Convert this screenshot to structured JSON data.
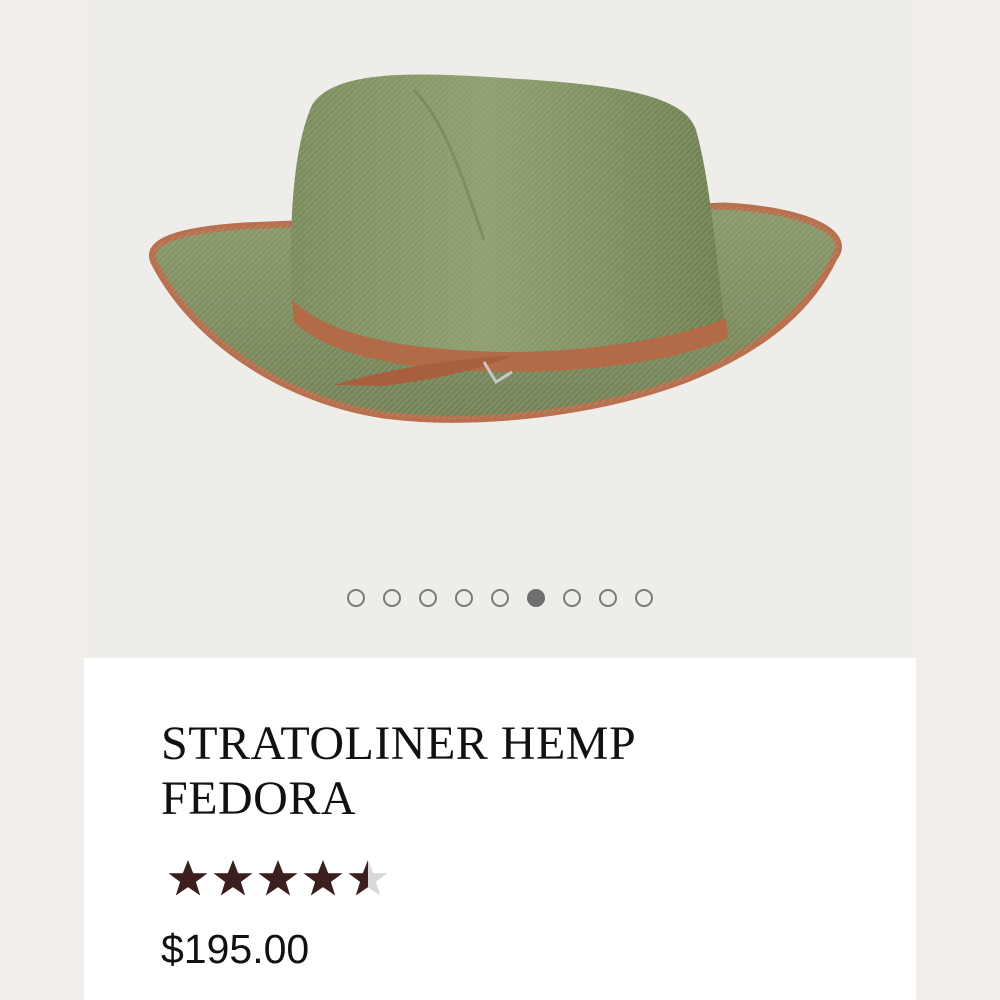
{
  "product": {
    "title": "STRATOLINER HEMP FEDORA",
    "price": "$195.00",
    "rating": 4.5,
    "rating_max": 5,
    "star_color": "#3b1f1f",
    "star_empty_color": "#d8d8d8",
    "image_icon": "fedora-hat-photo"
  },
  "gallery": {
    "slide_count": 9,
    "active_index": 5
  }
}
